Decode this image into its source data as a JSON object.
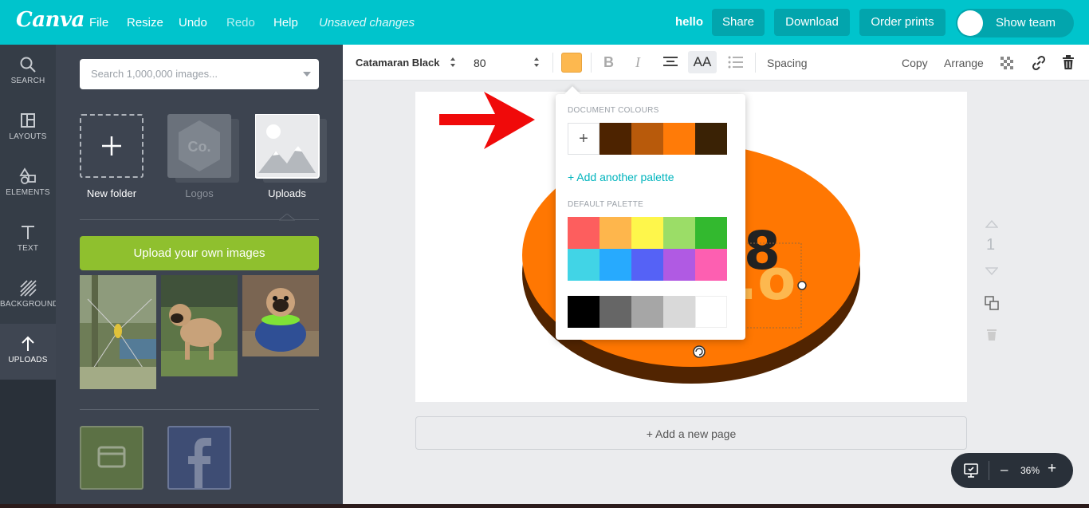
{
  "app": {
    "logo": "Canva",
    "menu": [
      "File",
      "Resize",
      "Undo",
      "Redo",
      "Help"
    ],
    "status": "Unsaved changes",
    "team_name": "hello",
    "buttons": {
      "share": "Share",
      "download": "Download",
      "order_prints": "Order prints",
      "show_team": "Show team"
    },
    "accent": "#00c4cc"
  },
  "rail": {
    "items": [
      {
        "label": "SEARCH",
        "icon": "search-icon"
      },
      {
        "label": "LAYOUTS",
        "icon": "layouts-icon"
      },
      {
        "label": "ELEMENTS",
        "icon": "elements-icon"
      },
      {
        "label": "TEXT",
        "icon": "text-icon"
      },
      {
        "label": "BACKGROUND",
        "icon": "background-icon"
      },
      {
        "label": "UPLOADS",
        "icon": "upload-arrow-icon",
        "active": true
      }
    ]
  },
  "panel": {
    "search_placeholder": "Search 1,000,000 images...",
    "folders": [
      {
        "label": "New folder",
        "icon": "plus-icon"
      },
      {
        "label": "Logos",
        "icon_text": "Co."
      },
      {
        "label": "Uploads",
        "icon": "image-placeholder-icon"
      }
    ],
    "upload_button": "Upload your own images",
    "upload_color": "#8fc02e",
    "images": [
      "spider photo",
      "pug standing photo",
      "pug in sweater photo"
    ]
  },
  "toolbar": {
    "font": "Catamaran Black",
    "size": "80",
    "text_color": "#fdb84f",
    "aa": "AA",
    "spacing": "Spacing",
    "copy": "Copy",
    "arrange": "Arrange"
  },
  "canvas": {
    "add_page": "+ Add a new page",
    "page_number": "1"
  },
  "color_picker": {
    "document_heading": "DOCUMENT COLOURS",
    "document_colors": [
      "#4d2300",
      "#b85a0b",
      "#ff7b08",
      "#3a2205"
    ],
    "add_palette": "+ Add another palette",
    "default_heading": "DEFAULT PALETTE",
    "default_row1": [
      "#fd5e5e",
      "#feb64c",
      "#fef64b",
      "#9bdd67",
      "#33b92f"
    ],
    "default_row2": [
      "#41d4e6",
      "#27aafe",
      "#5562f6",
      "#b05ae3",
      "#fd5fb1"
    ],
    "grayscale": [
      "#000000",
      "#666666",
      "#a6a6a6",
      "#d9d9d9",
      "#ffffff"
    ]
  },
  "zoom": {
    "value": "36%",
    "minus": "–",
    "plus": "+"
  }
}
